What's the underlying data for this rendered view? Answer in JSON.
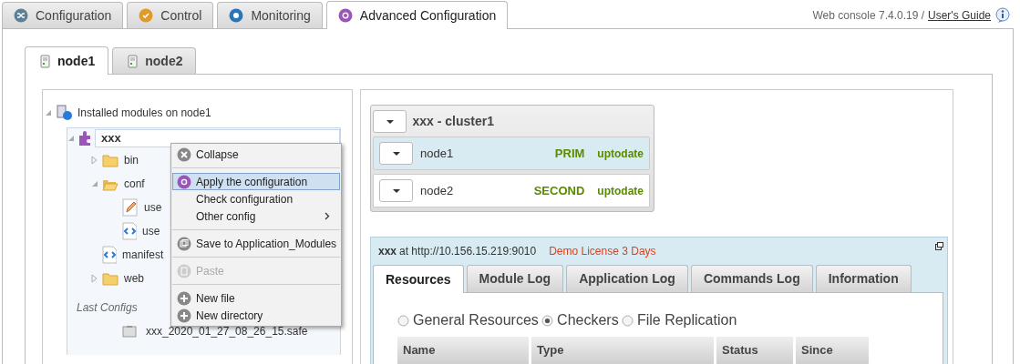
{
  "main_tabs": [
    {
      "label": "Configuration",
      "kind": "shuffle",
      "selected": false
    },
    {
      "label": "Control",
      "kind": "check",
      "selected": false
    },
    {
      "label": "Monitoring",
      "kind": "record",
      "selected": false
    },
    {
      "label": "Advanced Configuration",
      "kind": "gear",
      "selected": true
    }
  ],
  "header": {
    "version": "Web console 7.4.0.19 /",
    "guide_link": "User's Guide"
  },
  "node_tabs": [
    {
      "label": "node1",
      "selected": true
    },
    {
      "label": "node2",
      "selected": false
    }
  ],
  "tree": {
    "label": "Installed modules on node1",
    "expanded": true,
    "module": {
      "label": "xxx",
      "expanded": true,
      "children": [
        {
          "label": "bin",
          "kind": "folder",
          "expanded": false
        },
        {
          "label": "conf",
          "kind": "folder",
          "expanded": true,
          "children": [
            {
              "label": "use",
              "kind": "pencil"
            },
            {
              "label": "use",
              "kind": "xml"
            }
          ]
        },
        {
          "label": "manifest",
          "kind": "xml"
        },
        {
          "label": "web",
          "kind": "folder",
          "expanded": false
        }
      ]
    },
    "last_configs": {
      "title": "Last Configs",
      "items": [
        "xxx_2020_01_27_08_26_15.safe"
      ]
    }
  },
  "context_menu": [
    {
      "kind": "close",
      "label": "Collapse",
      "disabled": false,
      "selected": false
    },
    {
      "kind": "separator"
    },
    {
      "kind": "gear",
      "label": "Apply the configuration",
      "disabled": false,
      "selected": true
    },
    {
      "kind": "plain",
      "label": "Check configuration",
      "disabled": false,
      "selected": false
    },
    {
      "kind": "plain",
      "label": "Other config",
      "disabled": false,
      "selected": false,
      "submenu": true
    },
    {
      "kind": "separator"
    },
    {
      "kind": "save",
      "label": "Save to Application_Modules",
      "disabled": false,
      "selected": false
    },
    {
      "kind": "separator"
    },
    {
      "kind": "paste",
      "label": "Paste",
      "disabled": true,
      "selected": false
    },
    {
      "kind": "separator"
    },
    {
      "kind": "plus",
      "label": "New file",
      "disabled": false,
      "selected": false
    },
    {
      "kind": "plus",
      "label": "New directory",
      "disabled": false,
      "selected": false
    }
  ],
  "cluster": {
    "title": "xxx - cluster1",
    "nodes": [
      {
        "name": "node1",
        "role": "PRIM",
        "state": "uptodate",
        "selected": true
      },
      {
        "name": "node2",
        "role": "SECOND",
        "state": "uptodate",
        "selected": false
      }
    ]
  },
  "module_panel": {
    "name": "xxx",
    "url": "at http://10.156.15.219:9010",
    "license": "Demo License 3 Days",
    "tabs": [
      {
        "label": "Resources",
        "selected": true
      },
      {
        "label": "Module Log",
        "selected": false
      },
      {
        "label": "Application Log",
        "selected": false
      },
      {
        "label": "Commands Log",
        "selected": false
      },
      {
        "label": "Information",
        "selected": false
      }
    ],
    "radios": [
      {
        "label": "General Resources",
        "checked": false
      },
      {
        "label": "Checkers",
        "checked": true
      },
      {
        "label": "File Replication",
        "checked": false
      }
    ],
    "table": {
      "columns": [
        "Name",
        "Type",
        "Status",
        "Since"
      ]
    }
  }
}
